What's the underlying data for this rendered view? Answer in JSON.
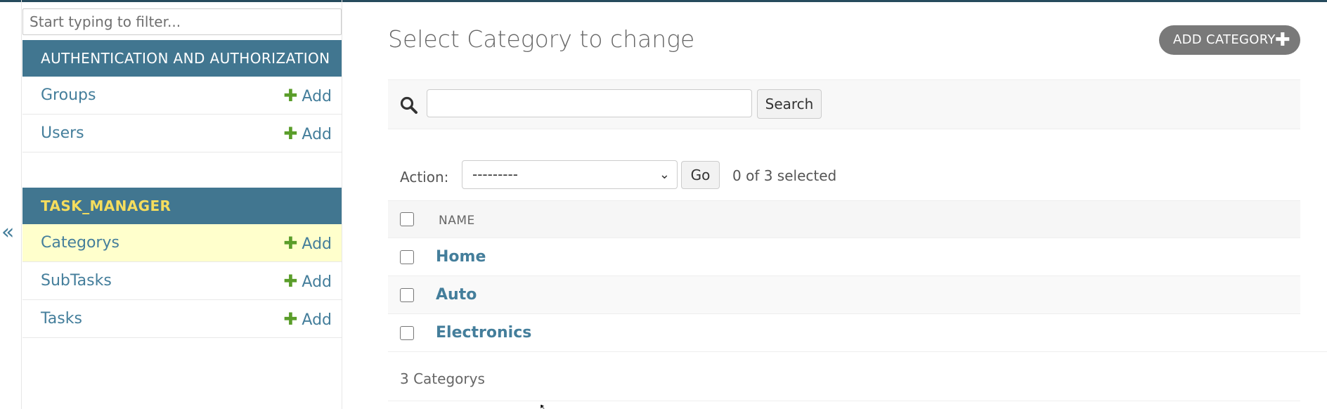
{
  "sidebar": {
    "filter_placeholder": "Start typing to filter...",
    "collapse_glyph": "«",
    "modules": [
      {
        "caption": "AUTHENTICATION AND AUTHORIZATION",
        "models": [
          {
            "name": "Groups",
            "add": "Add"
          },
          {
            "name": "Users",
            "add": "Add"
          }
        ]
      },
      {
        "caption": "TASK_MANAGER",
        "models": [
          {
            "name": "Categorys",
            "add": "Add"
          },
          {
            "name": "SubTasks",
            "add": "Add"
          },
          {
            "name": "Tasks",
            "add": "Add"
          }
        ]
      }
    ]
  },
  "content": {
    "title": "Select Category to change",
    "add_button": "ADD CATEGORY",
    "search_button": "Search",
    "action_label": "Action:",
    "action_selected": "---------",
    "go_button": "Go",
    "selection_counter": "0 of 3 selected",
    "column_header": "NAME",
    "rows": [
      "Home",
      "Auto",
      "Electronics"
    ],
    "result_count": "3 Categorys"
  },
  "colors": {
    "module_header": "#417690",
    "module_header_app_text": "#f5dd5d",
    "link": "#447e9b",
    "add_plus": "#5a9d2a",
    "selected_row": "#ffffcc",
    "add_button_bg": "#797979"
  },
  "icons": {
    "search": "search-icon",
    "plus": "plus-icon",
    "chevron": "chevron-down-icon",
    "collapse": "collapse-sidebar-icon"
  }
}
